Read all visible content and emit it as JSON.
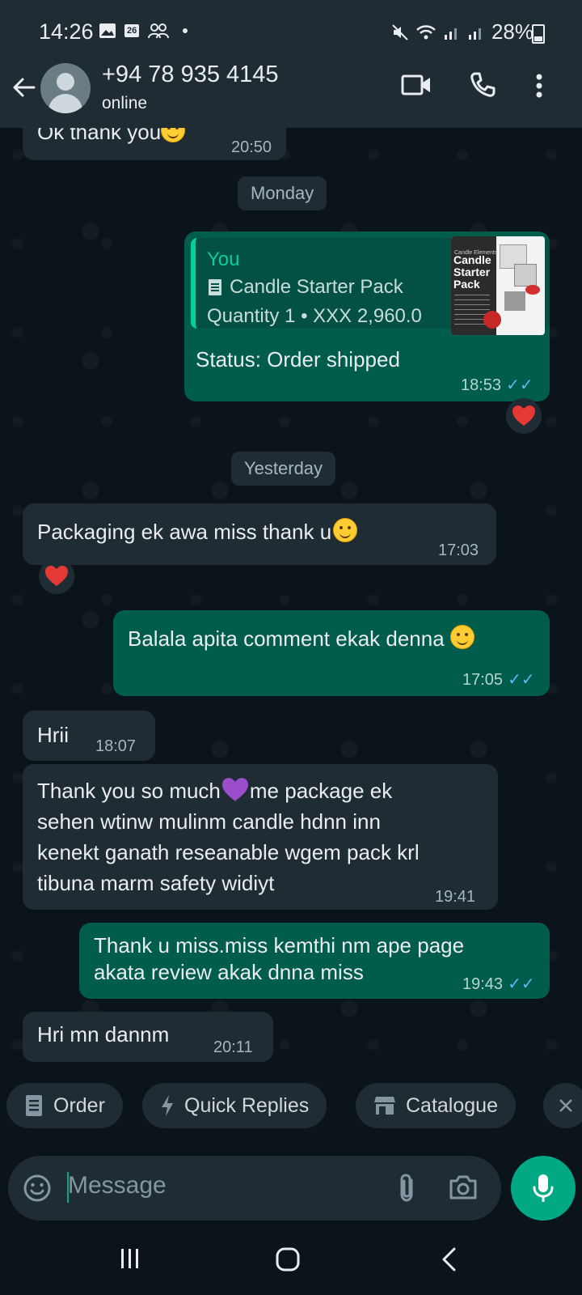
{
  "status_bar": {
    "time": "14:26",
    "notif_badge": "26",
    "battery": "28%"
  },
  "header": {
    "contact": "+94 78 935 4145",
    "status": "online"
  },
  "messages": [
    {
      "kind": "in",
      "text": "Ok thank you",
      "time": "20:50"
    },
    {
      "kind": "date",
      "text": "Monday"
    },
    {
      "kind": "order",
      "quote_author": "You",
      "product": "Candle Starter Pack",
      "quantity": "Quantity 1 • XXX 2,960.0",
      "thumb_brand": "Candle Elements",
      "thumb_title": "Candle Starter Pack",
      "text": "Status: Order shipped",
      "time": "18:53",
      "reaction": "heart"
    },
    {
      "kind": "date",
      "text": "Yesterday"
    },
    {
      "kind": "in",
      "text": "Packaging ek awa miss thank u",
      "time": "17:03",
      "reaction": "heart"
    },
    {
      "kind": "out",
      "text": "Balala apita comment ekak denna",
      "time": "17:05"
    },
    {
      "kind": "in",
      "text": "Hrii",
      "time": "18:07"
    },
    {
      "kind": "in",
      "lines": [
        "Thank you so much",
        "me package ek",
        "sehen wtinw mulinm candle hdnn inn",
        "kenekt ganath reseanable wgem pack krl",
        "tibuna marm safety widiyt"
      ],
      "time": "19:41"
    },
    {
      "kind": "out",
      "lines": [
        "Thank u miss.miss kemthi nm ape page",
        "akata review akak dnna miss"
      ],
      "time": "19:43"
    },
    {
      "kind": "in",
      "text": "Hri mn dannm",
      "time": "20:11"
    }
  ],
  "chips": [
    "Order",
    "Quick Replies",
    "Catalogue"
  ],
  "input": {
    "placeholder": "Message"
  },
  "colors": {
    "header": "#1f2c34",
    "incoming": "#1f2c34",
    "outgoing": "#005c4b",
    "accent": "#00a884",
    "read_ticks": "#53bdeb"
  }
}
